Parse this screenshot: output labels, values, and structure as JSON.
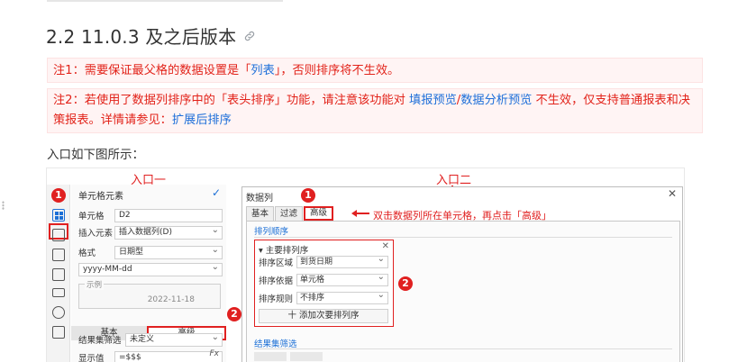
{
  "section": {
    "title": "2.2 11.0.3 及之后版本"
  },
  "note1": {
    "prefix": "注1：需要保证最父格的数据设置是「",
    "link": "列表",
    "suffix": "」，否则排序将不生效。"
  },
  "note2": {
    "part1": "注2：若使用了数据列排序中的「表头排序」功能，请注意该功能对 ",
    "link1": "填报预览",
    "sep": "/",
    "link2": "数据分析预览",
    "part2": " 不生效，仅支持普通报表和决策报表。详情请参见：",
    "link3": "扩展后排序"
  },
  "intro": "入口如下图所示：",
  "figure": {
    "entry1": "入口一",
    "entry2": "入口二",
    "badge1": "1",
    "badge2": "2",
    "left_panel": {
      "title": "单元格元素",
      "check": "✓",
      "cell_label": "单元格",
      "cell_value": "D2",
      "insert_label": "插入元素",
      "insert_value": "插入数据列(D)",
      "format_label": "格式",
      "format_value": "日期型",
      "pattern_value": "yyyy-MM-dd",
      "demo_legend": "示例",
      "demo_value": "2022-11-18",
      "tab_basic": "基本",
      "tab_adv": "高级",
      "filter_label": "结果集筛选",
      "filter_value": "未定义",
      "display_label": "显示值",
      "display_value": "=$$$",
      "fx": "Fx"
    },
    "dialog": {
      "title": "数据列",
      "close": "✕",
      "tab_basic": "基本",
      "tab_filter": "过滤",
      "tab_adv": "高级",
      "instruction": "双击数据列所在单元格，再点击「高级」",
      "sort_section": "排列顺序",
      "main_sort": "主要排列序",
      "sort_area_label": "排序区域",
      "sort_area_value": "到货日期",
      "sort_by_label": "排序依据",
      "sort_by_value": "单元格",
      "sort_rule_label": "排序规则",
      "sort_rule_value": "不排序",
      "add_button": "十 添加次要排列序",
      "filter_section": "结果集筛选"
    }
  }
}
